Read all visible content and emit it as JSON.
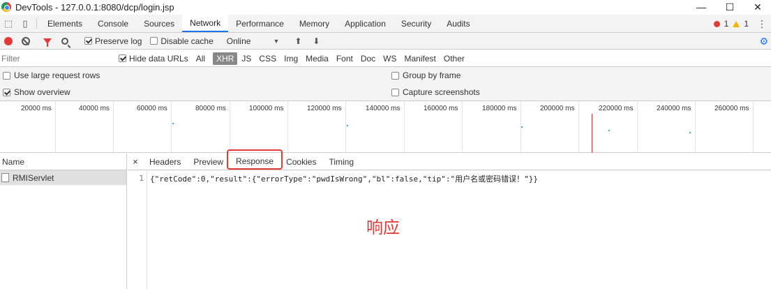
{
  "window": {
    "title": "DevTools - 127.0.0.1:8080/dcp/login.jsp",
    "controls": [
      "—",
      "☐",
      "✕"
    ]
  },
  "panel_tabs": [
    "Elements",
    "Console",
    "Sources",
    "Network",
    "Performance",
    "Memory",
    "Application",
    "Security",
    "Audits"
  ],
  "active_panel": "Network",
  "status": {
    "errors": "1",
    "warnings": "1"
  },
  "toolbar": {
    "preserve_log": "Preserve log",
    "disable_cache": "Disable cache",
    "throttle": "Online",
    "throttle_arrow": "▼"
  },
  "filter": {
    "placeholder": "Filter",
    "hide_data_urls": "Hide data URLs",
    "types": [
      "All",
      "XHR",
      "JS",
      "CSS",
      "Img",
      "Media",
      "Font",
      "Doc",
      "WS",
      "Manifest",
      "Other"
    ],
    "active_type": "XHR"
  },
  "options": {
    "large_rows": "Use large request rows",
    "show_overview": "Show overview",
    "group_by_frame": "Group by frame",
    "capture_screenshots": "Capture screenshots"
  },
  "overview": {
    "tick_labels": [
      "20000 ms",
      "40000 ms",
      "60000 ms",
      "80000 ms",
      "100000 ms",
      "120000 ms",
      "140000 ms",
      "160000 ms",
      "180000 ms",
      "200000 ms",
      "220000 ms",
      "240000 ms",
      "260000 ms"
    ]
  },
  "requests": {
    "header": "Name",
    "items": [
      "RMIServlet"
    ]
  },
  "detail": {
    "close": "×",
    "tabs": [
      "Headers",
      "Preview",
      "Response",
      "Cookies",
      "Timing"
    ],
    "active_tab": "Response",
    "line_number": "1",
    "response_body": "{\"retCode\":0,\"result\":{\"errorType\":\"pwdIsWrong\",\"bl\":false,\"tip\":\"用户名或密码错误！\"}}"
  },
  "annotation": "响应",
  "colors": {
    "accent": "#1a73e8",
    "record": "#e53935",
    "highlight": "#e53935"
  }
}
